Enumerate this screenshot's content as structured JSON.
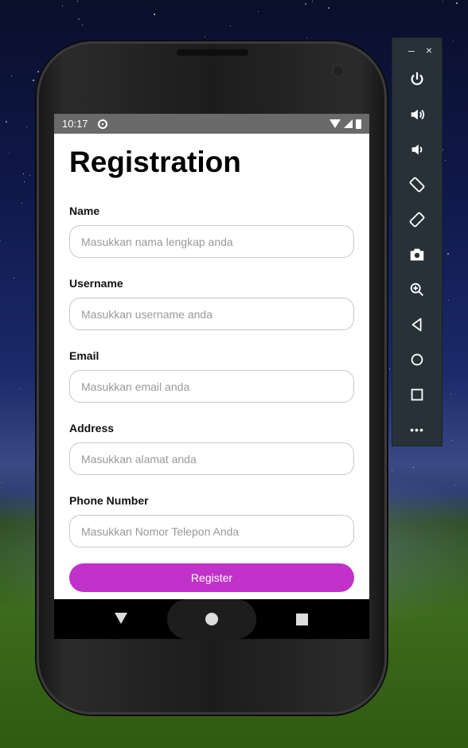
{
  "status_bar": {
    "time": "10:17"
  },
  "form": {
    "title": "Registration",
    "fields": [
      {
        "label": "Name",
        "placeholder": "Masukkan nama lengkap anda"
      },
      {
        "label": "Username",
        "placeholder": "Masukkan username anda"
      },
      {
        "label": "Email",
        "placeholder": "Masukkan email anda"
      },
      {
        "label": "Address",
        "placeholder": "Masukkan alamat anda"
      },
      {
        "label": "Phone Number",
        "placeholder": "Masukkan Nomor Telepon Anda"
      }
    ],
    "submit_label": "Register",
    "accent_color": "#c032c9"
  },
  "emulator_toolbar": {
    "window_controls": {
      "minimize": "–",
      "close": "×"
    },
    "buttons": [
      "power-icon",
      "volume-up-icon",
      "volume-down-icon",
      "rotate-left-icon",
      "rotate-right-icon",
      "camera-icon",
      "zoom-icon",
      "back-icon",
      "home-icon",
      "overview-icon",
      "more-icon"
    ],
    "more_glyph": "•••"
  }
}
